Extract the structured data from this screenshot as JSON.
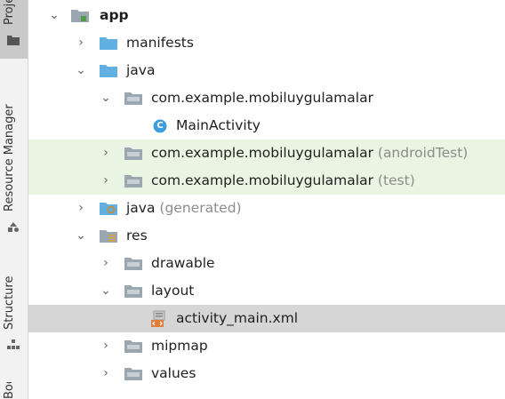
{
  "tool_window_strip": {
    "project_tab_label": "Project",
    "resource_manager_tab_label": "Resource Manager",
    "structure_tab_label": "Structure",
    "bottom_tab_label": "Bookmarks"
  },
  "tree": {
    "rows": [
      {
        "label": "app",
        "suffix": "",
        "expanded": true,
        "icon": "module-folder-icon",
        "selected": false,
        "highlighted": false
      },
      {
        "label": "manifests",
        "suffix": "",
        "expanded": false,
        "icon": "folder-icon",
        "selected": false,
        "highlighted": false
      },
      {
        "label": "java",
        "suffix": "",
        "expanded": true,
        "icon": "source-folder-icon",
        "selected": false,
        "highlighted": false
      },
      {
        "label": "com.example.mobiluygulamalar",
        "suffix": "",
        "expanded": true,
        "icon": "package-icon",
        "selected": false,
        "highlighted": false
      },
      {
        "label": "MainActivity",
        "suffix": "",
        "expanded": null,
        "icon": "class-icon",
        "class_glyph": "C",
        "selected": false,
        "highlighted": false
      },
      {
        "label": "com.example.mobiluygulamalar",
        "suffix": "(androidTest)",
        "expanded": false,
        "icon": "package-icon",
        "selected": false,
        "highlighted": true
      },
      {
        "label": "com.example.mobiluygulamalar",
        "suffix": "(test)",
        "expanded": false,
        "icon": "package-icon",
        "selected": false,
        "highlighted": true
      },
      {
        "label": "java",
        "suffix": "(generated)",
        "expanded": false,
        "icon": "generated-folder-icon",
        "selected": false,
        "highlighted": false
      },
      {
        "label": "res",
        "suffix": "",
        "expanded": true,
        "icon": "resource-folder-icon",
        "selected": false,
        "highlighted": false
      },
      {
        "label": "drawable",
        "suffix": "",
        "expanded": false,
        "icon": "package-icon",
        "selected": false,
        "highlighted": false
      },
      {
        "label": "layout",
        "suffix": "",
        "expanded": true,
        "icon": "package-icon",
        "selected": false,
        "highlighted": false
      },
      {
        "label": "activity_main.xml",
        "suffix": "",
        "expanded": null,
        "icon": "layout-xml-icon",
        "selected": true,
        "highlighted": false
      },
      {
        "label": "mipmap",
        "suffix": "",
        "expanded": false,
        "icon": "package-icon",
        "selected": false,
        "highlighted": false
      },
      {
        "label": "values",
        "suffix": "",
        "expanded": false,
        "icon": "package-icon",
        "selected": false,
        "highlighted": false
      }
    ]
  },
  "colors": {
    "folder_blue": "#62afe1",
    "package_gray": "#9aa7b0",
    "class_circle": "#3f9ddb",
    "xml_orange": "#e07b39",
    "highlight_green": "#eaf4e2",
    "selected_gray": "#d6d6d6"
  }
}
